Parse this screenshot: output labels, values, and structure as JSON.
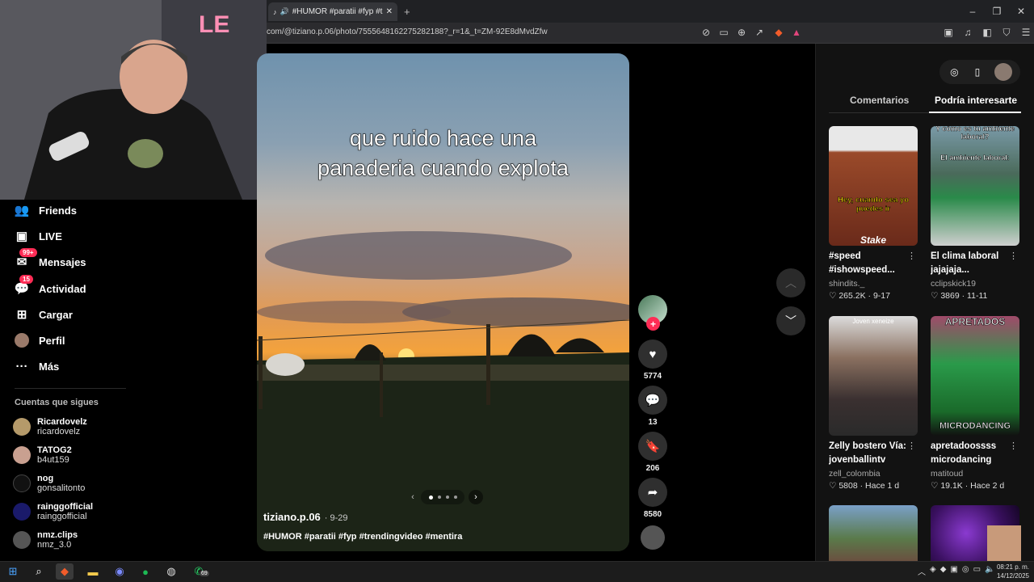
{
  "browser": {
    "tab_title": "#HUMOR #paratii #fyp #trendi",
    "new_tab": "+",
    "url": "com/@tiziano.p.06/photo/7555648162275282188?_r=1&_t=ZM-92E8dMvdZfw"
  },
  "sidebar": {
    "items": [
      {
        "label": "Friends",
        "icon": "friends-icon"
      },
      {
        "label": "LIVE",
        "icon": "live-icon"
      },
      {
        "label": "Mensajes",
        "icon": "messages-icon",
        "badge": "99+"
      },
      {
        "label": "Actividad",
        "icon": "activity-icon",
        "badge": "15"
      },
      {
        "label": "Cargar",
        "icon": "upload-icon"
      },
      {
        "label": "Perfil",
        "icon": "profile-icon"
      },
      {
        "label": "Más",
        "icon": "more-icon"
      }
    ],
    "following_title": "Cuentas que sigues",
    "following": [
      {
        "name": "Ricardovelz",
        "handle": "ricardovelz"
      },
      {
        "name": "TATOG2",
        "handle": "b4ut159"
      },
      {
        "name": "nog",
        "handle": "gonsalitonto"
      },
      {
        "name": "rainggofficial",
        "handle": "rainggofficial"
      },
      {
        "name": "nmz.clips",
        "handle": "nmz_3.0"
      }
    ]
  },
  "post": {
    "caption_line1": "que ruido hace una",
    "caption_line2": "panaderia cuando explota",
    "author": "tiziano.p.06",
    "date": "· 9-29",
    "hashtags": "#HUMOR #paratii #fyp #trendingvideo #mentira",
    "likes": "5774",
    "comments": "13",
    "saves": "206",
    "shares": "8580"
  },
  "panel": {
    "tab_comments": "Comentarios",
    "tab_suggested": "Podría interesarte",
    "cards": [
      {
        "title": "#speed #ishowspeed...",
        "user": "shindits._",
        "likes": "265.2K",
        "date": "9-17",
        "overlay": "Hey, cuando sea yo puedes ir",
        "brand": "Stake",
        "bg": "#8a3a1a"
      },
      {
        "title": "El clima laboral jajajaja...",
        "user": "cclipskick19",
        "likes": "3869",
        "date": "11-11",
        "overlay": "Y cómo es tu ambiente laboral?",
        "sub": "El ambiente laboral:",
        "bg": "#5a7a8a"
      },
      {
        "title": "Zelly bostero Vía: jovenballintv Zell...",
        "user": "zell_colombia",
        "likes": "5808",
        "date": "Hace 1 d",
        "overlay": "Joven xeneize",
        "bg": "#6b5a4e"
      },
      {
        "title": "apretadoossss microdancing 🎶...",
        "user": "matitoud",
        "likes": "19.1K",
        "date": "Hace 2 d",
        "overlay": "APRETADOS",
        "sub": "MICRODANCING",
        "bg": "#1f7a3a"
      }
    ]
  },
  "taskbar": {
    "time": "08:21 p. m.",
    "date": "14/12/2025",
    "whatsapp_badge": "69"
  }
}
